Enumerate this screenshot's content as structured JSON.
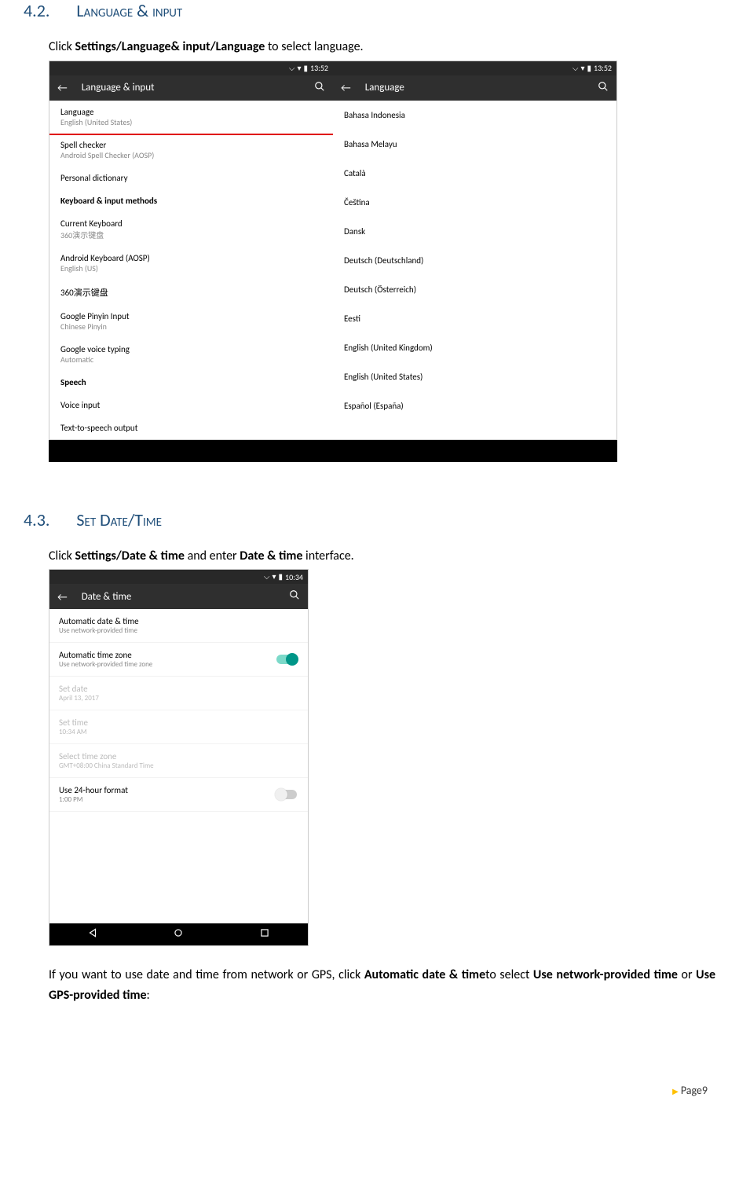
{
  "section42": {
    "number": "4.2.",
    "title": "Language & input",
    "body_pre": "Click ",
    "body_bold": "Settings/Language& input/Language",
    "body_post": " to select language."
  },
  "section43": {
    "number": "4.3.",
    "title": "Set Date/Time",
    "body_pre": "Click ",
    "body_bold1": "Settings/Date & time",
    "body_mid": " and enter ",
    "body_bold2": "Date & time",
    "body_post": " interface.",
    "para2_part1": "If you want to use date and time from network or GPS, click ",
    "para2_bold1": "Automatic date & time",
    "para2_part2": "to select ",
    "para2_bold2": "Use network-provided time",
    "para2_part3": " or ",
    "para2_bold3": "Use GPS-provided time",
    "para2_part4": ":"
  },
  "android": {
    "status_time1": "13:52",
    "status_time2": "13:52",
    "status_time3": "10:34",
    "toolbar_lang_input": "Language & input",
    "toolbar_language": "Language",
    "toolbar_datetime": "Date & time"
  },
  "lang_input_list": [
    {
      "title": "Language",
      "sub": "English (United States)"
    },
    {
      "title": "Spell checker",
      "sub": "Android Spell Checker (AOSP)"
    },
    {
      "title": "Personal dictionary",
      "sub": ""
    },
    {
      "title": "Keyboard & input methods",
      "sub": "",
      "header": true
    },
    {
      "title": "Current Keyboard",
      "sub": "360演示键盘"
    },
    {
      "title": "Android Keyboard (AOSP)",
      "sub": "English (US)"
    },
    {
      "title": "360演示键盘",
      "sub": ""
    },
    {
      "title": "Google Pinyin Input",
      "sub": "Chinese Pinyin"
    },
    {
      "title": "Google voice typing",
      "sub": "Automatic"
    },
    {
      "title": "Speech",
      "sub": "",
      "header": true
    },
    {
      "title": "Voice input",
      "sub": ""
    },
    {
      "title": "Text-to-speech output",
      "sub": ""
    }
  ],
  "language_list": [
    "Bahasa Indonesia",
    "Bahasa Melayu",
    "Català",
    "Čeština",
    "Dansk",
    "Deutsch (Deutschland)",
    "Deutsch (Österreich)",
    "Eesti",
    "English (United Kingdom)",
    "English (United States)",
    "Español (España)"
  ],
  "datetime_list": [
    {
      "title": "Automatic date & time",
      "sub": "Use network-provided time"
    },
    {
      "title": "Automatic time zone",
      "sub": "Use network-provided time zone",
      "switch": "on"
    },
    {
      "title": "Set date",
      "sub": "April 13, 2017",
      "disabled": true
    },
    {
      "title": "Set time",
      "sub": "10:34 AM",
      "disabled": true
    },
    {
      "title": "Select time zone",
      "sub": "GMT+08:00 China Standard Time",
      "disabled": true
    },
    {
      "title": "Use 24-hour format",
      "sub": "1:00 PM",
      "switch": "off"
    }
  ],
  "footer": {
    "label": "Page9"
  }
}
